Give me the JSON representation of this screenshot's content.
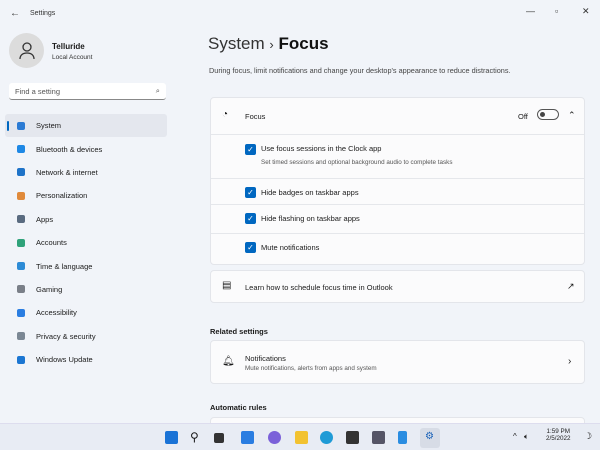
{
  "window": {
    "title": "Settings"
  },
  "user": {
    "name": "Telluride",
    "account": "Local Account"
  },
  "search": {
    "placeholder": "Find a setting"
  },
  "sidebar": {
    "items": [
      {
        "label": "System",
        "icon": "monitor-icon",
        "color": "#2b7bd4"
      },
      {
        "label": "Bluetooth & devices",
        "icon": "bluetooth-icon",
        "color": "#1e88e5"
      },
      {
        "label": "Network & internet",
        "icon": "wifi-icon",
        "color": "#1e73c8"
      },
      {
        "label": "Personalization",
        "icon": "brush-icon",
        "color": "#e08a3b"
      },
      {
        "label": "Apps",
        "icon": "apps-icon",
        "color": "#5a6b80"
      },
      {
        "label": "Accounts",
        "icon": "person-icon",
        "color": "#2fa27a"
      },
      {
        "label": "Time & language",
        "icon": "globe-clock-icon",
        "color": "#2d8bd6"
      },
      {
        "label": "Gaming",
        "icon": "controller-icon",
        "color": "#7a7f88"
      },
      {
        "label": "Accessibility",
        "icon": "accessibility-icon",
        "color": "#2a7de1"
      },
      {
        "label": "Privacy & security",
        "icon": "shield-icon",
        "color": "#7b8794"
      },
      {
        "label": "Windows Update",
        "icon": "update-icon",
        "color": "#1b76d2"
      }
    ],
    "selected": 0
  },
  "header": {
    "parent": "System",
    "separator": "›",
    "title": "Focus",
    "description": "During focus, limit notifications and change your desktop's appearance to reduce distractions."
  },
  "focus": {
    "label": "Focus",
    "state": "Off",
    "toggle_on": false,
    "expanded": true,
    "options": [
      {
        "label": "Use focus sessions in the Clock app",
        "sub": "Set timed sessions and optional background audio to complete tasks",
        "checked": true
      },
      {
        "label": "Hide badges on taskbar apps",
        "checked": true
      },
      {
        "label": "Hide flashing on taskbar apps",
        "checked": true
      },
      {
        "label": "Mute notifications",
        "checked": true
      }
    ]
  },
  "outlook": {
    "label": "Learn how to schedule focus time in Outlook"
  },
  "related": {
    "title": "Related settings",
    "notifications": {
      "label": "Notifications",
      "sub": "Mute notifications, alerts from apps and system"
    }
  },
  "automatic": {
    "title": "Automatic rules"
  },
  "taskbar": {
    "time": "1:59 PM",
    "date": "2/5/2022",
    "accent": "#0067c0"
  }
}
